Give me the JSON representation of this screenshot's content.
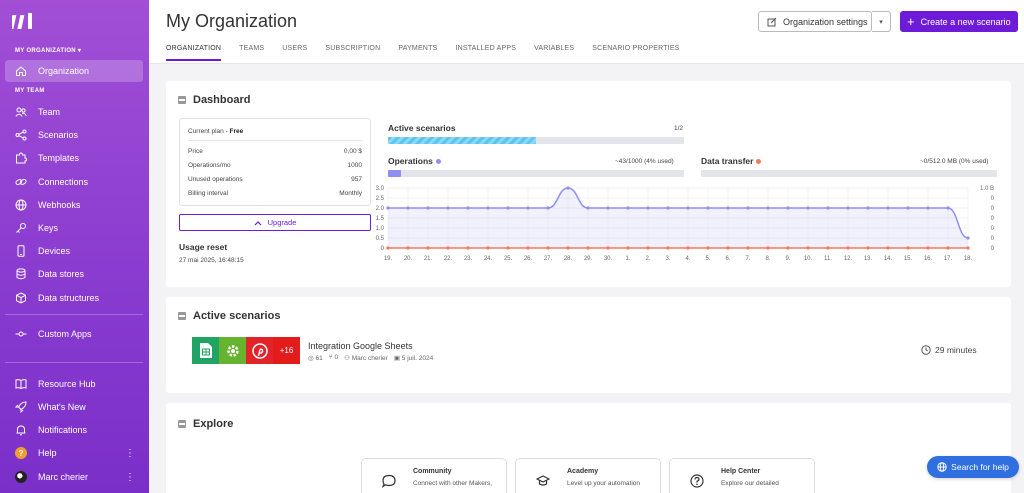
{
  "sidebar": {
    "org_selector": "MY ORGANIZATION ▾",
    "section_my_team": "MY TEAM",
    "items": [
      {
        "label": "Organization",
        "icon": "home-icon"
      },
      {
        "label": "Team",
        "icon": "team-icon"
      },
      {
        "label": "Scenarios",
        "icon": "share-icon"
      },
      {
        "label": "Templates",
        "icon": "puzzle-icon"
      },
      {
        "label": "Connections",
        "icon": "link-icon"
      },
      {
        "label": "Webhooks",
        "icon": "globe-icon"
      },
      {
        "label": "Keys",
        "icon": "key-icon"
      },
      {
        "label": "Devices",
        "icon": "phone-icon"
      },
      {
        "label": "Data stores",
        "icon": "database-icon"
      },
      {
        "label": "Data structures",
        "icon": "cube-icon"
      },
      {
        "label": "Custom Apps",
        "icon": "node-icon"
      },
      {
        "label": "Resource Hub",
        "icon": "book-icon"
      },
      {
        "label": "What's New",
        "icon": "rocket-icon"
      },
      {
        "label": "Notifications",
        "icon": "bell-icon"
      },
      {
        "label": "Help",
        "icon": "help-icon"
      },
      {
        "label": "Marc cherier",
        "icon": "avatar-icon"
      }
    ]
  },
  "header": {
    "title": "My Organization",
    "settings_label": "Organization settings",
    "caret": "▾",
    "create_label": "Create a new scenario",
    "create_plus": "+",
    "tabs": [
      "ORGANIZATION",
      "TEAMS",
      "USERS",
      "SUBSCRIPTION",
      "PAYMENTS",
      "INSTALLED APPS",
      "VARIABLES",
      "SCENARIO PROPERTIES"
    ]
  },
  "dashboard": {
    "title": "Dashboard",
    "plan": {
      "current_plan_label": "Current plan - ",
      "current_plan_value": "Free",
      "rows": [
        {
          "label": "Price",
          "value": "0,00 $"
        },
        {
          "label": "Operations/mo",
          "value": "1000"
        },
        {
          "label": "Unused operations",
          "value": "957"
        },
        {
          "label": "Billing interval",
          "value": "Monthly"
        }
      ]
    },
    "upgrade_label": "Upgrade",
    "usage_reset_label": "Usage reset",
    "usage_reset_date": "27 mai 2025, 16:48:15",
    "active_scenarios_label": "Active scenarios",
    "active_scenarios_value": "1/2",
    "active_scenarios_fraction": 0.5,
    "operations_label": "Operations",
    "operations_value": "~43/1000 (4% used)",
    "operations_fraction": 0.043,
    "data_transfer_label": "Data transfer",
    "data_transfer_value": "~0/512.0 MB (0% used)",
    "data_transfer_fraction": 0.0,
    "colors": {
      "operations": "#8f8ff0",
      "data_transfer": "#f07a5a",
      "accent": "#6d1bd8",
      "active_bar": "#5bc4ef"
    }
  },
  "chart_data": {
    "type": "line",
    "x": [
      "19.",
      "20.",
      "21.",
      "22.",
      "23.",
      "24.",
      "25.",
      "26.",
      "27.",
      "28.",
      "29.",
      "30.",
      "1.",
      "2.",
      "3.",
      "4.",
      "5.",
      "6.",
      "7.",
      "8.",
      "9.",
      "10.",
      "11.",
      "12.",
      "13.",
      "14.",
      "15.",
      "16.",
      "17.",
      "18."
    ],
    "left_ticks": [
      "3.0",
      "2.5",
      "2.0",
      "1.5",
      "1.0",
      "0.5",
      "0"
    ],
    "right_ticks": [
      "1.0 B",
      "0",
      "0",
      "0",
      "0",
      "0",
      "0"
    ],
    "ylim": [
      0,
      3
    ],
    "series": [
      {
        "values": [
          2,
          2,
          2,
          2,
          2,
          2,
          2,
          2,
          2,
          3,
          2,
          2,
          2,
          2,
          2,
          2,
          2,
          2,
          2,
          2,
          2,
          2,
          2,
          2,
          2,
          2,
          2,
          2,
          2,
          0.5
        ]
      },
      {
        "values": [
          0,
          0,
          0,
          0,
          0,
          0,
          0,
          0,
          0,
          0,
          0,
          0,
          0,
          0,
          0,
          0,
          0,
          0,
          0,
          0,
          0,
          0,
          0,
          0,
          0,
          0,
          0,
          0,
          0,
          0
        ]
      }
    ]
  },
  "active_scenarios": {
    "title": "Active scenarios",
    "extra_count": "+16",
    "app_icons": [
      "google-sheets-icon",
      "gear-icon",
      "pinterest-icon"
    ],
    "name": "Integration Google Sheets",
    "id": "61",
    "count": "0",
    "owner": "Marc cherier",
    "date": "5 juil. 2024",
    "duration": "29 minutes"
  },
  "explore": {
    "title": "Explore",
    "cards": [
      {
        "title": "Community",
        "desc": "Connect with other Makers,",
        "icon": "chat-icon"
      },
      {
        "title": "Academy",
        "desc": "Level up your automation",
        "icon": "graduation-cap-icon"
      },
      {
        "title": "Help Center",
        "desc": "Explore our detailed",
        "icon": "question-icon"
      }
    ]
  },
  "help_button": "Search for help"
}
